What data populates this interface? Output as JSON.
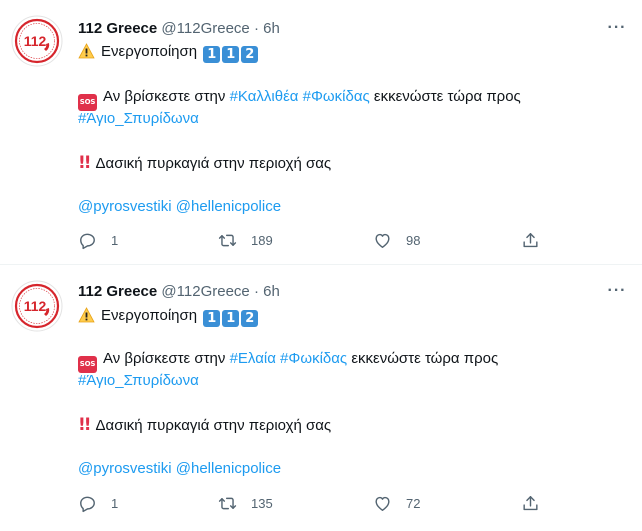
{
  "tweets": [
    {
      "name": "112 Greece",
      "handle": "@112Greece",
      "separator": "·",
      "time": "6h",
      "activation_text": "Ενεργοποίηση",
      "activation_digits": [
        "1",
        "1",
        "2"
      ],
      "sos_label": "SOS",
      "line1_prefix": "Αν βρίσκεστε στην ",
      "hashtag_place": "#Καλλιθέα",
      "hashtag_region": "#Φωκίδας",
      "line1_suffix": " εκκενώστε τώρα προς",
      "hashtag_destination": "#Άγιο_Σπυρίδωνα",
      "alert_text": "Δασική πυρκαγιά στην περιοχή σας",
      "mention1": "@pyrosvestiki",
      "mention2": "@hellenicpolice",
      "reply_count": "1",
      "retweet_count": "189",
      "like_count": "98"
    },
    {
      "name": "112 Greece",
      "handle": "@112Greece",
      "separator": "·",
      "time": "6h",
      "activation_text": "Ενεργοποίηση",
      "activation_digits": [
        "1",
        "1",
        "2"
      ],
      "sos_label": "SOS",
      "line1_prefix": "Αν βρίσκεστε στην ",
      "hashtag_place": "#Ελαία",
      "hashtag_region": "#Φωκίδας",
      "line1_suffix": " εκκενώστε τώρα προς",
      "hashtag_destination": "#Άγιο_Σπυρίδωνα",
      "alert_text": "Δασική πυρκαγιά στην περιοχή σας",
      "mention1": "@pyrosvestiki",
      "mention2": "@hellenicpolice",
      "reply_count": "1",
      "retweet_count": "135",
      "like_count": "72"
    }
  ],
  "icons": {
    "avatar": "112-logo-icon",
    "warning": "warning-icon",
    "more": "more-icon",
    "reply": "reply-icon",
    "retweet": "retweet-icon",
    "like": "like-icon",
    "share": "share-icon"
  },
  "colors": {
    "link": "#1d9bf0",
    "secondary_text": "#536471",
    "logo_red": "#d6252c",
    "keycap_blue": "#3a8fd6"
  }
}
